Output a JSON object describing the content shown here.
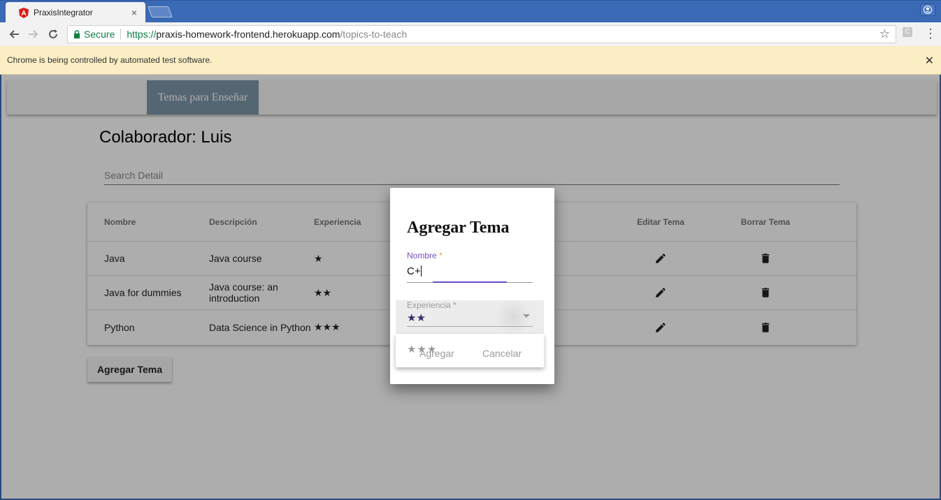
{
  "browser": {
    "tab_title": "PraxisIntegrator",
    "tab_close": "×",
    "secure_label": "Secure",
    "url_scheme": "https://",
    "url_host": "praxis-homework-frontend.herokuapp.com",
    "url_path": "/topics-to-teach",
    "extension_letter": "C",
    "infobar_text": "Chrome is being controlled by automated test software.",
    "infobar_close": "✕",
    "brand_color": "#3a69b5"
  },
  "navbar": {
    "active_item": "Temas para Enseñar"
  },
  "page": {
    "heading": "Colaborador: Luis",
    "search_placeholder": "Search Detail",
    "add_button": "Agregar Tema"
  },
  "table": {
    "headers": {
      "nombre": "Nombre",
      "descripcion": "Descripción",
      "experiencia": "Experiencia",
      "editar": "Editar Tema",
      "borrar": "Borrar Tema"
    },
    "rows": [
      {
        "nombre": "Java",
        "descripcion": "Java course",
        "experiencia": "★"
      },
      {
        "nombre": "Java for dummies",
        "descripcion": "Java course: an introduction",
        "experiencia": "★★"
      },
      {
        "nombre": "Python",
        "descripcion": "Data Science in Python",
        "experiencia": "★★★"
      }
    ]
  },
  "dialog": {
    "title": "Agregar Tema",
    "nombre_label": "Nombre",
    "required_mark": "*",
    "nombre_value": "C+",
    "experiencia_label": "Experiencia *",
    "experiencia_value": "★★",
    "dropdown_option": "★★★",
    "add_button": "Agregar",
    "cancel_button": "Cancelar"
  }
}
